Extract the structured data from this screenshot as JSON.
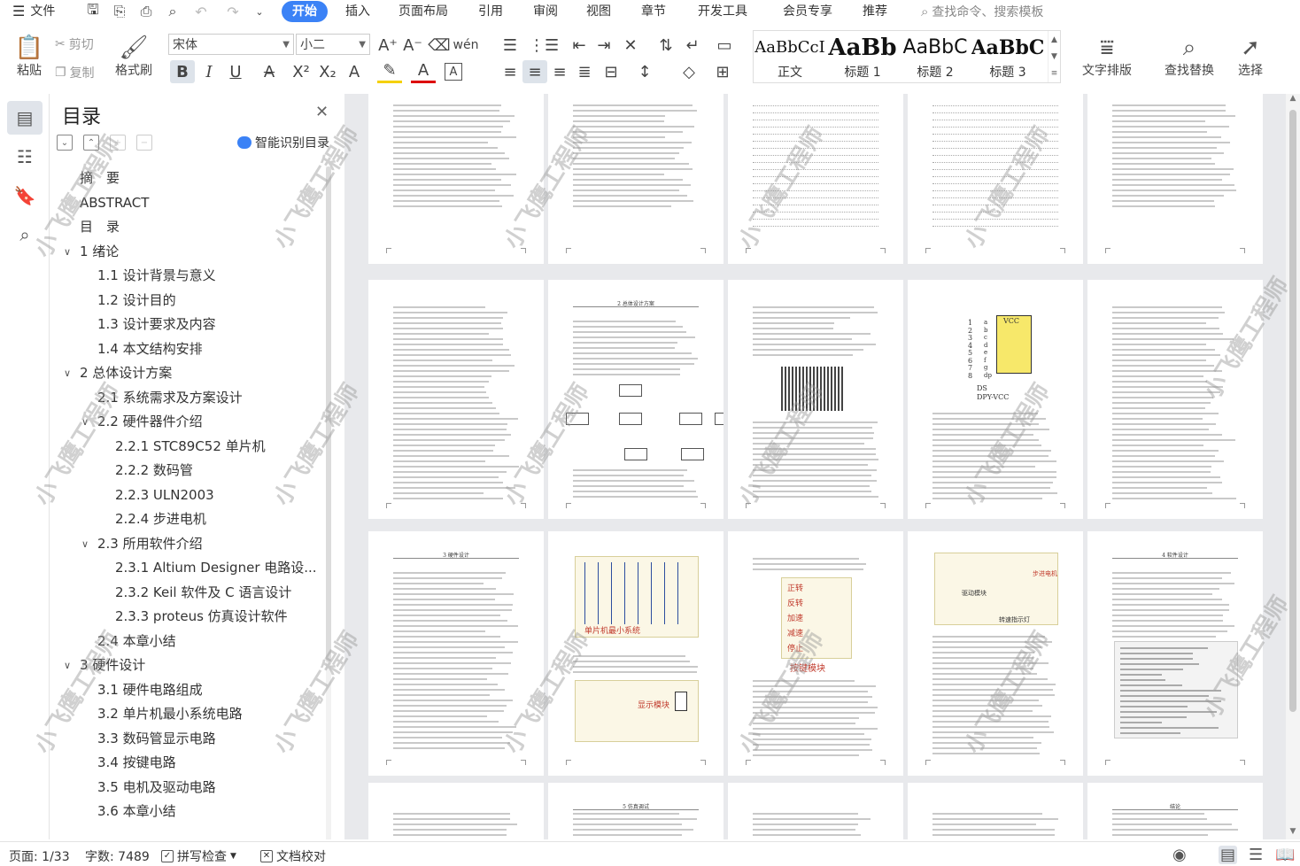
{
  "menubar": {
    "hamburger_label": "文件",
    "tabs": [
      "开始",
      "插入",
      "页面布局",
      "引用",
      "审阅",
      "视图",
      "章节",
      "开发工具",
      "会员专享",
      "推荐"
    ],
    "search_placeholder": "查找命令、搜索模板"
  },
  "ribbon": {
    "paste": "粘贴",
    "cut": "剪切",
    "copy": "复制",
    "format_painter": "格式刷",
    "font_name": "宋体",
    "font_size": "小二",
    "styles": [
      {
        "sample": "AaBbCcI",
        "name": "正文"
      },
      {
        "sample": "AaBb",
        "name": "标题 1"
      },
      {
        "sample": "AaBbC",
        "name": "标题 2"
      },
      {
        "sample": "AaBbC",
        "name": "标题 3"
      }
    ],
    "text_layout": "文字排版",
    "find_replace": "查找替换",
    "select": "选择"
  },
  "toc": {
    "title": "目录",
    "smart_label": "智能识别目录",
    "items": [
      {
        "label": "摘　要",
        "level": 0,
        "chevron": ""
      },
      {
        "label": "ABSTRACT",
        "level": 0,
        "chevron": ""
      },
      {
        "label": "目　录",
        "level": 0,
        "chevron": ""
      },
      {
        "label": "1  绪论",
        "level": 0,
        "chevron": "down"
      },
      {
        "label": "1.1  设计背景与意义",
        "level": 1,
        "chevron": ""
      },
      {
        "label": "1.2  设计目的",
        "level": 1,
        "chevron": ""
      },
      {
        "label": "1.3  设计要求及内容",
        "level": 1,
        "chevron": ""
      },
      {
        "label": "1.4  本文结构安排",
        "level": 1,
        "chevron": ""
      },
      {
        "label": "2  总体设计方案",
        "level": 0,
        "chevron": "down"
      },
      {
        "label": "2.1  系统需求及方案设计",
        "level": 1,
        "chevron": ""
      },
      {
        "label": "2.2  硬件器件介绍",
        "level": 1,
        "chevron": "down"
      },
      {
        "label": "2.2.1 STC89C52 单片机",
        "level": 2,
        "chevron": ""
      },
      {
        "label": "2.2.2 数码管",
        "level": 2,
        "chevron": ""
      },
      {
        "label": "2.2.3 ULN2003",
        "level": 2,
        "chevron": ""
      },
      {
        "label": "2.2.4  步进电机",
        "level": 2,
        "chevron": ""
      },
      {
        "label": "2.3  所用软件介绍",
        "level": 1,
        "chevron": "down"
      },
      {
        "label": "2.3.1 Altium Designer 电路设...",
        "level": 2,
        "chevron": ""
      },
      {
        "label": "2.3.2 Keil 软件及 C 语言设计",
        "level": 2,
        "chevron": ""
      },
      {
        "label": "2.3.3 proteus 仿真设计软件",
        "level": 2,
        "chevron": ""
      },
      {
        "label": "2.4  本章小结",
        "level": 1,
        "chevron": ""
      },
      {
        "label": "3  硬件设计",
        "level": 0,
        "chevron": "down"
      },
      {
        "label": "3.1  硬件电路组成",
        "level": 1,
        "chevron": ""
      },
      {
        "label": "3.2  单片机最小系统电路",
        "level": 1,
        "chevron": ""
      },
      {
        "label": "3.3 数码管显示电路",
        "level": 1,
        "chevron": ""
      },
      {
        "label": "3.4  按键电路",
        "level": 1,
        "chevron": ""
      },
      {
        "label": "3.5  电机及驱动电路",
        "level": 1,
        "chevron": ""
      },
      {
        "label": "3.6  本章小结",
        "level": 1,
        "chevron": ""
      }
    ]
  },
  "document": {
    "watermark": "小飞鹰工程师",
    "page_headers": [
      "2 总体设计方案",
      "3 硬件设计",
      "4 软件设计",
      "5 仿真调试",
      "结论"
    ],
    "figure_labels": {
      "mcu": "单片机最小系统",
      "display": "显示模块",
      "keys_title": "按键模块",
      "keys": [
        "正转",
        "反转",
        "加速",
        "减速",
        "停止"
      ],
      "stepper": "步进电机",
      "driver": "驱动模块",
      "dir": "转速指示灯",
      "seg_vcc": "VCC",
      "seg_ds": "DS",
      "seg_dpy": "DPY-VCC",
      "seg_letters": [
        "a",
        "b",
        "c",
        "d",
        "e",
        "f",
        "g",
        "dp"
      ],
      "seg_nums": [
        "1",
        "2",
        "3",
        "4",
        "5",
        "6",
        "7",
        "8"
      ]
    }
  },
  "status": {
    "page": "页面: 1/33",
    "words": "字数: 7489",
    "spell": "拼写检查",
    "proof": "文档校对"
  },
  "colors": {
    "accent": "#3b82f6",
    "sidebar_active": "#e0e4ea",
    "doc_background": "#e8e9ec"
  }
}
